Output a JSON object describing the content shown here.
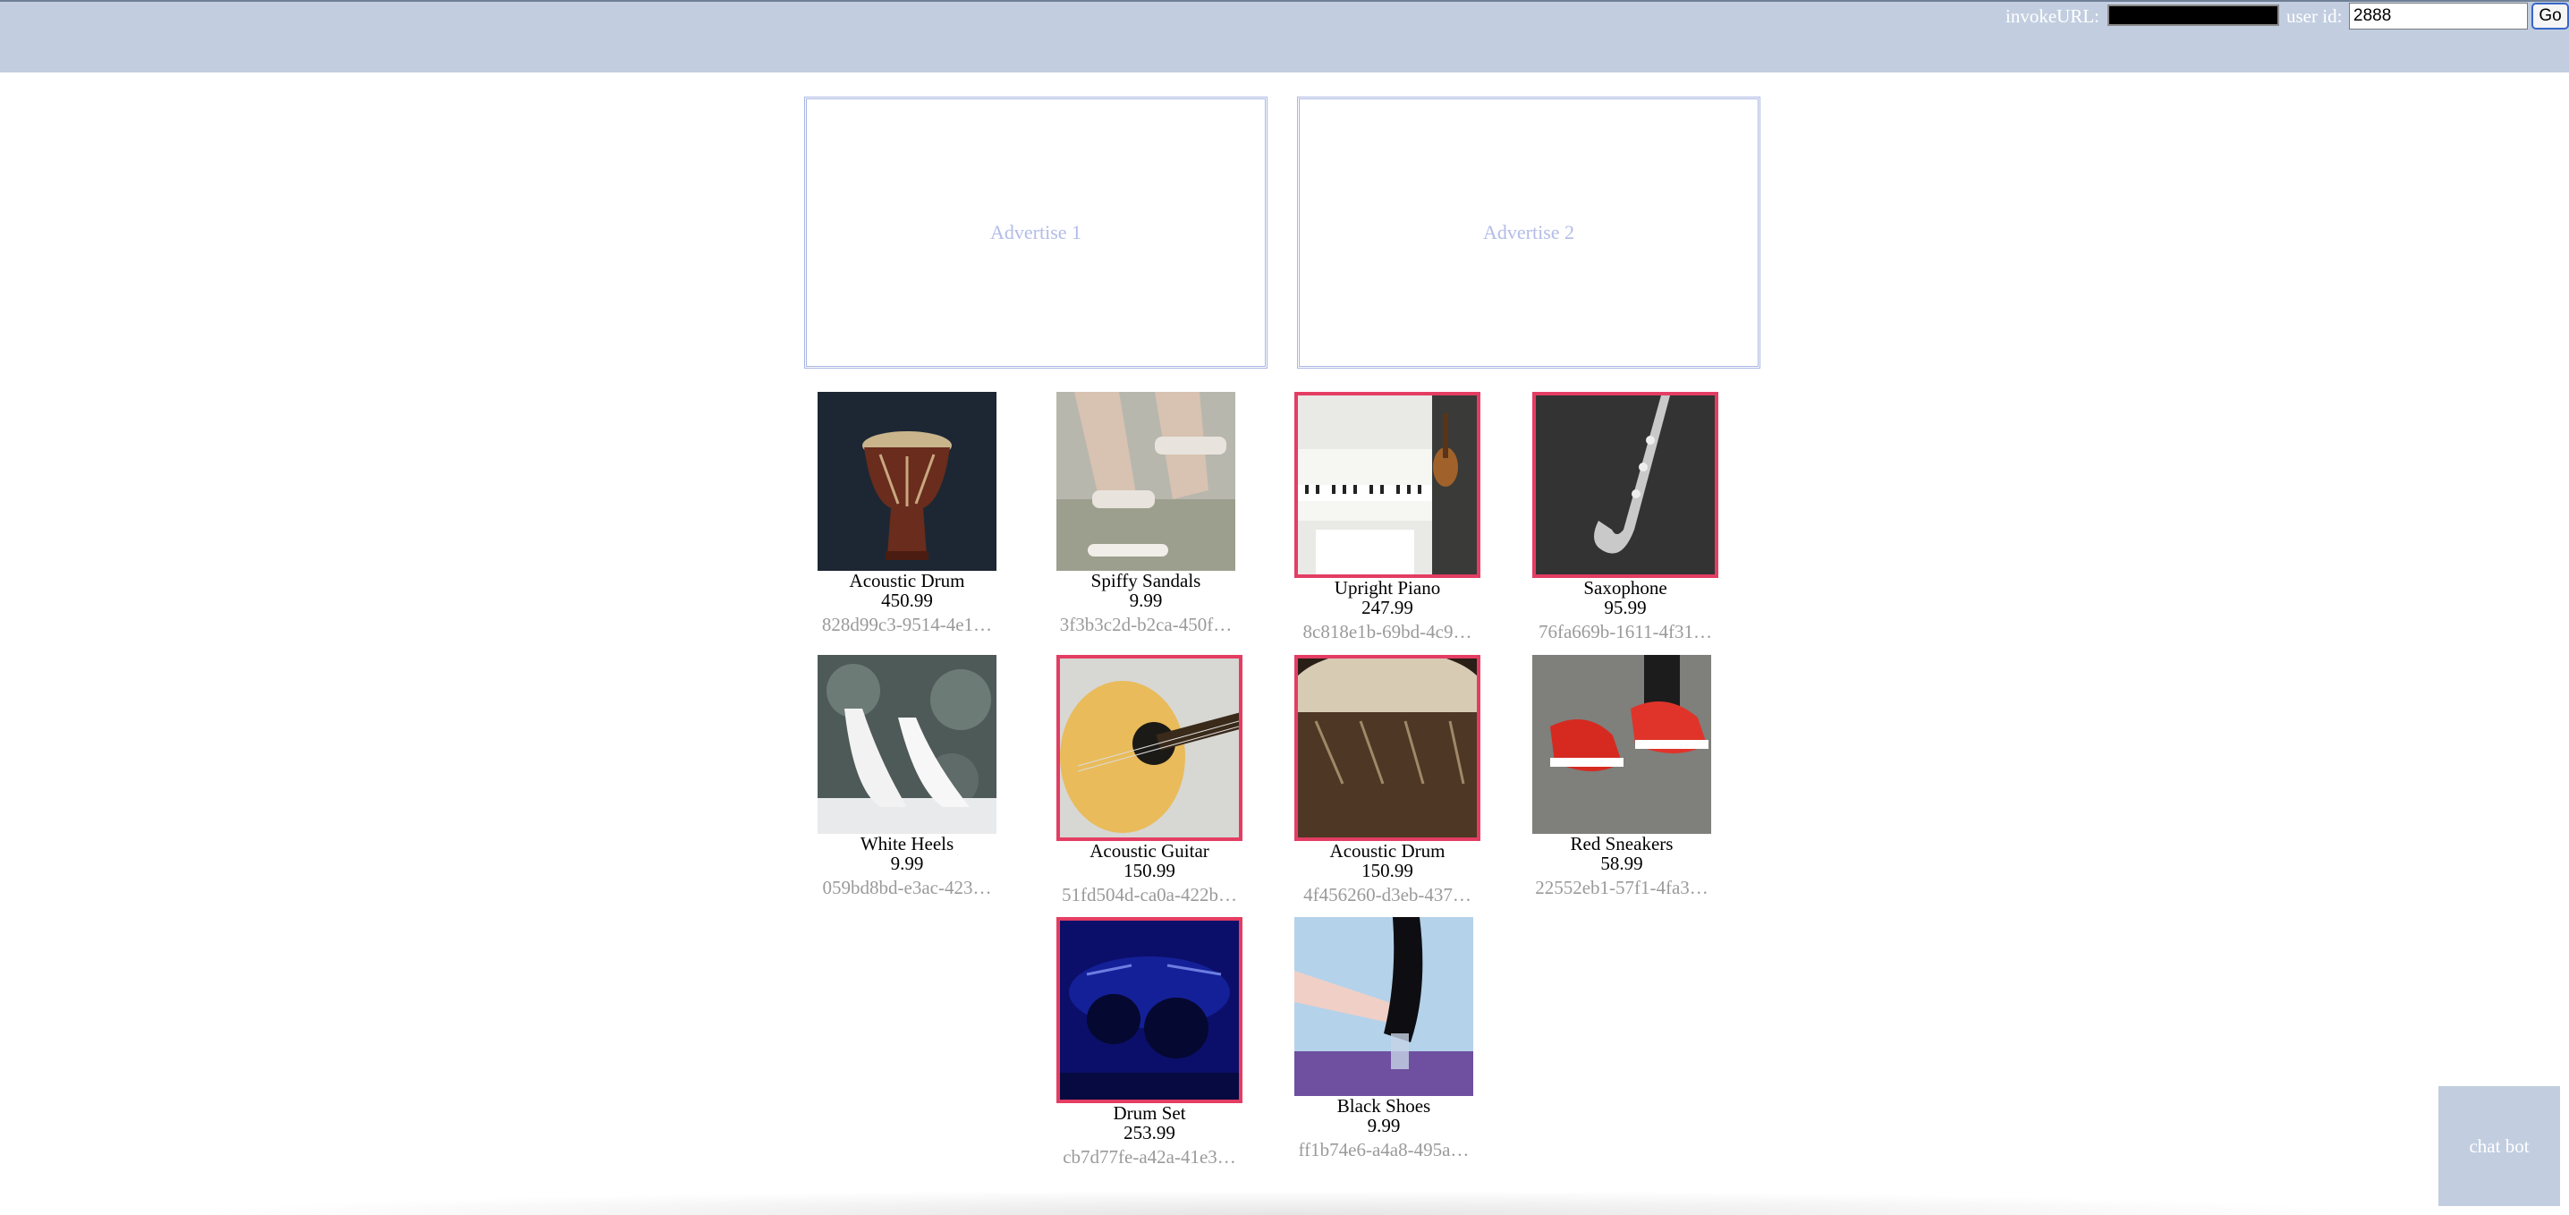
{
  "header": {
    "invoke_label": "invokeURL:",
    "invoke_value": "",
    "user_label": "user id:",
    "user_value": "2888",
    "go_label": "Go",
    "color": "#c2cee0"
  },
  "ads": [
    {
      "label": "Advertise 1"
    },
    {
      "label": "Advertise 2"
    }
  ],
  "products": [
    {
      "name": "Acoustic Drum",
      "price": "450.99",
      "id": "828d99c3-9514-4e1…",
      "icon": "djembe-drum-image",
      "highlighted": false
    },
    {
      "name": "Spiffy Sandals",
      "price": "9.99",
      "id": "3f3b3c2d-b2ca-450f…",
      "icon": "sandals-image",
      "highlighted": false
    },
    {
      "name": "Upright Piano",
      "price": "247.99",
      "id": "8c818e1b-69bd-4c9…",
      "icon": "piano-image",
      "highlighted": true
    },
    {
      "name": "Saxophone",
      "price": "95.99",
      "id": "76fa669b-1611-4f31…",
      "icon": "saxophone-image",
      "highlighted": true
    },
    {
      "name": "White Heels",
      "price": "9.99",
      "id": "059bd8bd-e3ac-423…",
      "icon": "white-heels-image",
      "highlighted": false
    },
    {
      "name": "Acoustic Guitar",
      "price": "150.99",
      "id": "51fd504d-ca0a-422b…",
      "icon": "guitar-image",
      "highlighted": true
    },
    {
      "name": "Acoustic Drum",
      "price": "150.99",
      "id": "4f456260-d3eb-437…",
      "icon": "drum-image",
      "highlighted": true
    },
    {
      "name": "Red Sneakers",
      "price": "58.99",
      "id": "22552eb1-57f1-4fa3…",
      "icon": "red-sneakers-image",
      "highlighted": false
    },
    {
      "name": "Drum Set",
      "price": "253.99",
      "id": "cb7d77fe-a42a-41e3…",
      "icon": "drum-set-image",
      "highlighted": true
    },
    {
      "name": "Black Shoes",
      "price": "9.99",
      "id": "ff1b74e6-a4a8-495a…",
      "icon": "black-shoes-image",
      "highlighted": false
    }
  ],
  "chatbot": {
    "label": "chat bot"
  },
  "colors": {
    "highlight": "#e43d63",
    "ad_border": "#a9b6e3",
    "muted_text": "#9a9a9a"
  }
}
